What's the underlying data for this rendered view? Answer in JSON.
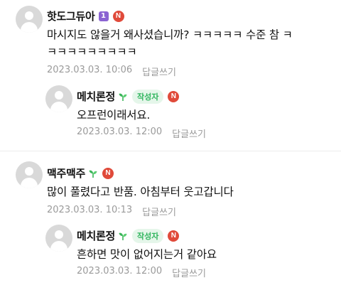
{
  "comments": [
    {
      "author": "핫도그듀아",
      "level_badge": "1",
      "new_badge": "N",
      "text_line1": "마시지도 않을거 왜사셨습니까? ㅋㅋㅋㅋㅋ 수준 참 ㅋ",
      "text_line2": "ㅋㅋㅋㅋㅋㅋㅋㅋㅋ",
      "date": "2023.03.03. 10:06",
      "reply_label": "답글쓰기",
      "reply": {
        "author": "메치론정",
        "writer_badge": "작성자",
        "new_badge": "N",
        "text": "오프런이래서요.",
        "date": "2023.03.03. 12:00",
        "reply_label": "답글쓰기"
      }
    },
    {
      "author": "맥주맥주",
      "new_badge": "N",
      "text": "많이 풀렸다고 반품. 아침부터 웃고갑니다",
      "date": "2023.03.03. 10:13",
      "reply_label": "답글쓰기",
      "reply": {
        "author": "메치론정",
        "writer_badge": "작성자",
        "new_badge": "N",
        "text": "흔하면 맛이 없어지는거 같아요",
        "date": "2023.03.03. 12:00",
        "reply_label": "답글쓰기"
      }
    }
  ],
  "icons": {
    "avatar": "default-profile-icon",
    "sprout": "sprout-icon"
  },
  "colors": {
    "writer_badge_bg": "#e5f6ea",
    "writer_badge_text": "#2fb55d",
    "new_badge": "#e04a3a",
    "level_badge": "#8a63d2",
    "meta_text": "#9a9a9a"
  }
}
